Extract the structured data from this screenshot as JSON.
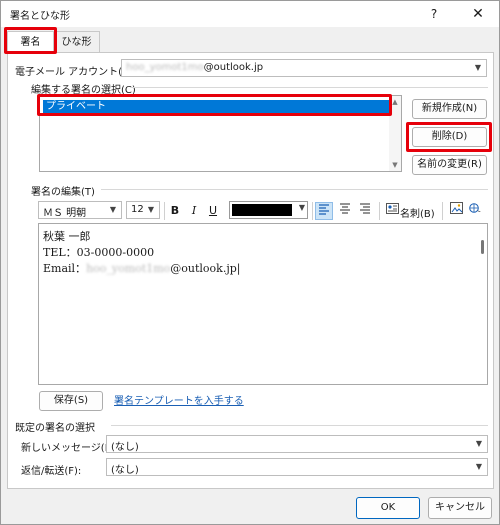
{
  "window": {
    "title": "署名とひな形",
    "help_glyph": "?",
    "close_glyph": "✕"
  },
  "tabs": [
    {
      "label": "署名"
    },
    {
      "label": "ひな形"
    }
  ],
  "email_account": {
    "label": "電子メール アカウント(A):",
    "value_hidden": "hoo_yomot1mo",
    "value_domain": "@outlook.jp"
  },
  "select_signature": {
    "label": "編集する署名の選択(C)",
    "items": [
      "プライベート"
    ]
  },
  "signature_buttons": {
    "new": "新規作成(N)",
    "delete": "削除(D)",
    "rename": "名前の変更(R)"
  },
  "edit_signature": {
    "label": "署名の編集(T)",
    "font": "ＭＳ 明朝",
    "size": "12",
    "bold": "B",
    "italic": "I",
    "underline": "U",
    "business_card": "名刺(B)",
    "text_color": "#000000",
    "lines": [
      "秋葉 一郎",
      "TEL：03-0000-0000"
    ],
    "email_prefix": "Email：",
    "email_hidden": "hoo_yomot1mo",
    "email_domain": "@outlook.jp"
  },
  "save_button": "保存(S)",
  "template_link": "署名テンプレートを入手する",
  "default_signature": {
    "heading": "既定の署名の選択",
    "new_messages_label": "新しいメッセージ(M):",
    "new_messages_value": "(なし)",
    "replies_label": "返信/転送(F):",
    "replies_value": "(なし)"
  },
  "footer": {
    "ok": "OK",
    "cancel": "キャンセル"
  },
  "colors": {
    "highlight_box": "#e6000a",
    "selection": "#0078d7"
  }
}
